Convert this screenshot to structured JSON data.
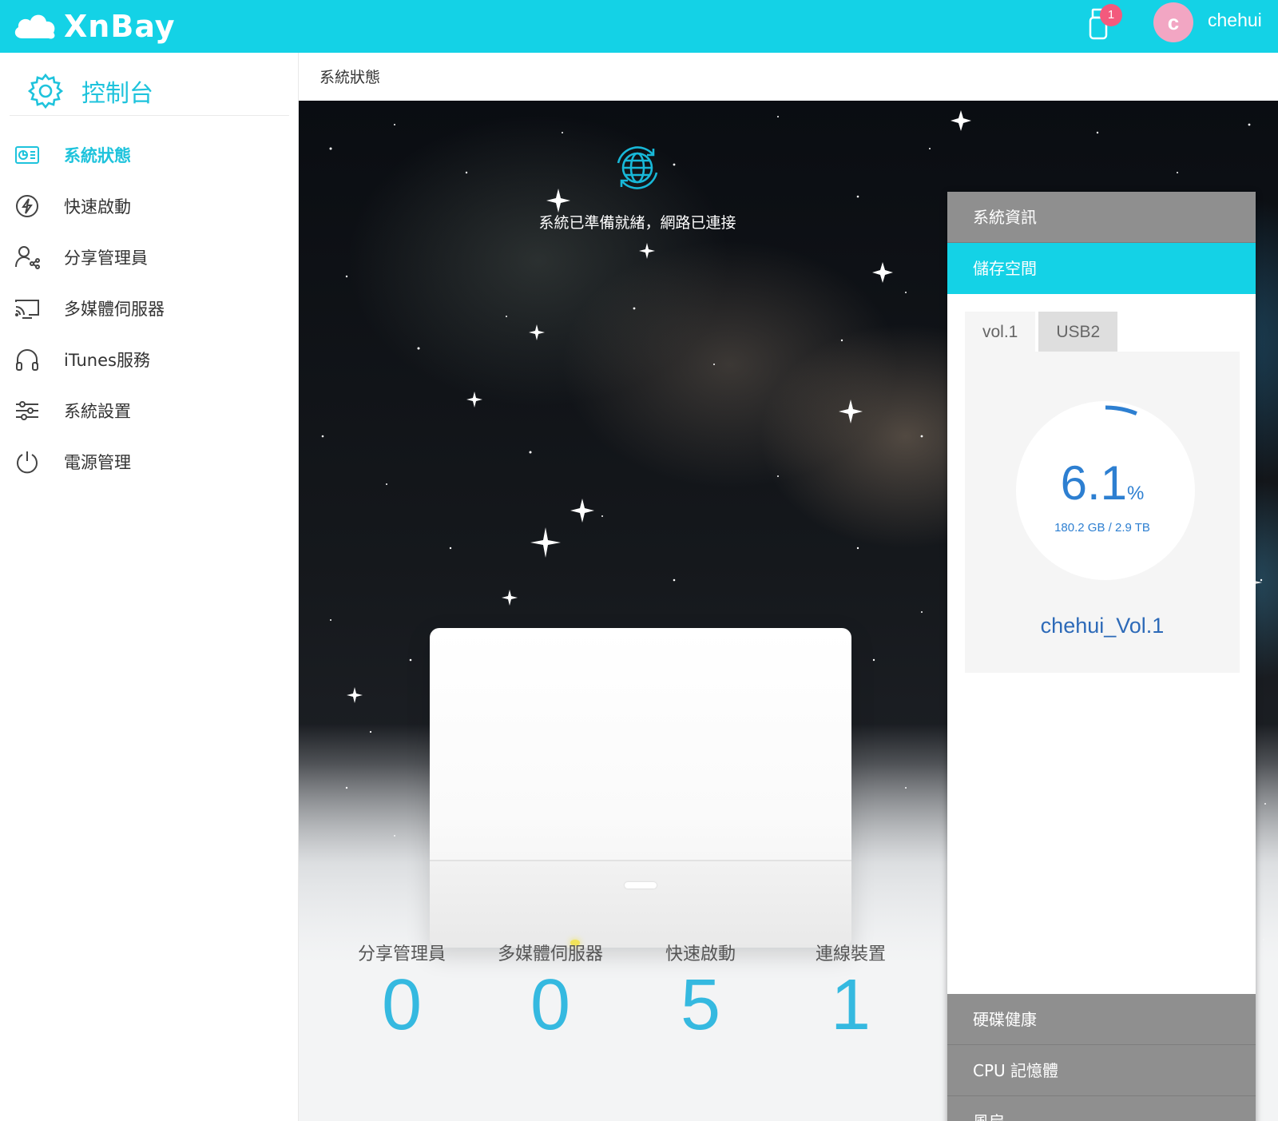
{
  "app": {
    "name": "XnBay"
  },
  "topbar": {
    "usb_badge": "1",
    "avatar_initial": "c",
    "username": "chehui"
  },
  "sidebar": {
    "title": "控制台",
    "items": [
      {
        "label": "系統狀態",
        "icon": "dashboard-icon",
        "active": true
      },
      {
        "label": "快速啟動",
        "icon": "lightning-icon"
      },
      {
        "label": "分享管理員",
        "icon": "user-share-icon"
      },
      {
        "label": "多媒體伺服器",
        "icon": "cast-icon"
      },
      {
        "label": "iTunes服務",
        "icon": "headphones-icon"
      },
      {
        "label": "系統設置",
        "icon": "sliders-icon"
      },
      {
        "label": "電源管理",
        "icon": "power-icon"
      }
    ]
  },
  "main": {
    "breadcrumb": "系統狀態",
    "status_text": "系統已準備就緒，網路已連接",
    "stats": [
      {
        "label": "分享管理員",
        "value": "0"
      },
      {
        "label": "多媒體伺服器",
        "value": "0"
      },
      {
        "label": "快速啟動",
        "value": "5"
      },
      {
        "label": "連線裝置",
        "value": "1"
      }
    ]
  },
  "panel": {
    "sections": [
      "系統資訊",
      "儲存空間",
      "硬碟健康",
      "CPU 記憶體",
      "風扇"
    ],
    "storage": {
      "tabs": [
        "vol.1",
        "USB2"
      ],
      "usage_percent": "6.1",
      "usage_unit": "%",
      "usage_fraction": 0.061,
      "usage_size": "180.2 GB / 2.9 TB",
      "volume_name": "chehui_Vol.1"
    }
  },
  "colors": {
    "accent": "#14d2e6",
    "link": "#2d7fd1",
    "stat": "#35b9e0",
    "panel_gray": "#8f8f8f"
  }
}
